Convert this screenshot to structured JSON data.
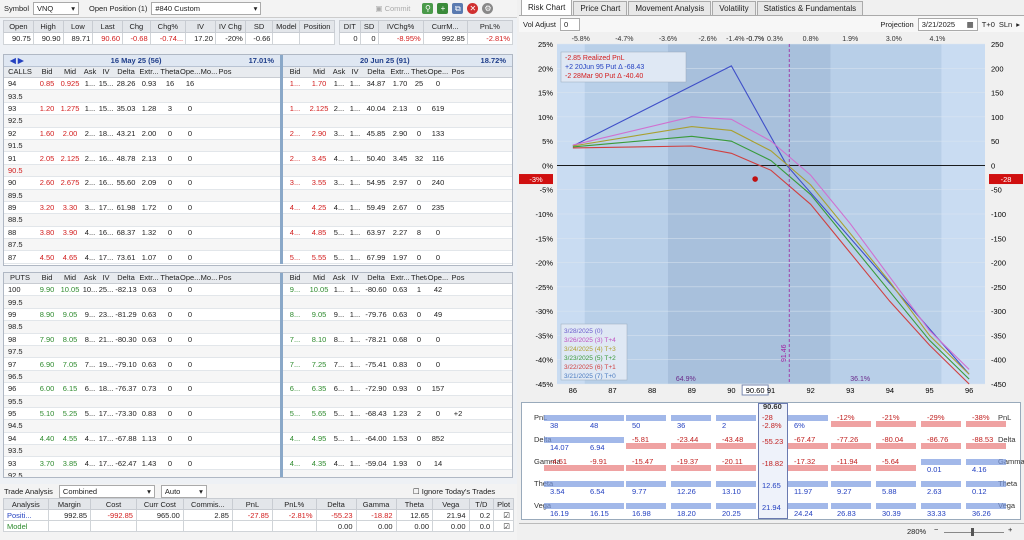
{
  "toolbar": {
    "symbol_label": "Symbol",
    "symbol_value": "VNQ",
    "open_position_label": "Open Position (1)",
    "position_value": "#840 Custom",
    "commit_label": "Commit"
  },
  "quote": {
    "headers": [
      "Open",
      "High",
      "Low",
      "Last",
      "Chg",
      "Chg%",
      "IV",
      "IV Chg",
      "SD",
      "Model",
      "Position"
    ],
    "values": [
      "90.75",
      "90.90",
      "89.71",
      "90.60",
      "-0.68",
      "-0.74...",
      "17.20",
      "-20%",
      "-0.66",
      "",
      ""
    ],
    "headers2": [
      "DIT",
      "SD",
      "IVChg%",
      "CurrM...",
      "PnL%"
    ],
    "values2": [
      "0",
      "0",
      "-8.95%",
      "992.85",
      "-2.81%"
    ]
  },
  "calls_panel": {
    "label": "CALLS",
    "left_title": "16 May 25 (56)",
    "left_iv": "17.01%",
    "right_title": "20 Jun 25 (91)",
    "right_iv": "18.72%",
    "columns": [
      "Bid",
      "Mid",
      "Ask",
      "IV",
      "Delta",
      "Extr...",
      "Theta",
      "Ope...",
      "Mo...",
      "Pos"
    ],
    "rows_left": [
      [
        "94",
        "0.85",
        "0.925",
        "1...",
        "15...",
        "28.26",
        "0.93",
        "16",
        "16",
        ""
      ],
      [
        "93.5",
        "",
        "",
        "",
        "",
        "",
        "",
        "",
        "",
        ""
      ],
      [
        "93",
        "1.20",
        "1.275",
        "1...",
        "15...",
        "35.03",
        "1.28",
        "3",
        "0",
        ""
      ],
      [
        "92.5",
        "",
        "",
        "",
        "",
        "",
        "",
        "",
        "",
        ""
      ],
      [
        "92",
        "1.60",
        "2.00",
        "2...",
        "18...",
        "43.21",
        "2.00",
        "0",
        "0",
        ""
      ],
      [
        "91.5",
        "",
        "",
        "",
        "",
        "",
        "",
        "",
        "",
        ""
      ],
      [
        "91",
        "2.05",
        "2.125",
        "2...",
        "16...",
        "48.78",
        "2.13",
        "0",
        "0",
        ""
      ],
      [
        "90.5",
        "",
        "",
        "",
        "",
        "",
        "",
        "",
        "",
        ""
      ],
      [
        "90",
        "2.60",
        "2.675",
        "2...",
        "16...",
        "55.60",
        "2.09",
        "0",
        "0",
        ""
      ],
      [
        "89.5",
        "",
        "",
        "",
        "",
        "",
        "",
        "",
        "",
        ""
      ],
      [
        "89",
        "3.20",
        "3.30",
        "3...",
        "17...",
        "61.98",
        "1.72",
        "0",
        "0",
        ""
      ],
      [
        "88.5",
        "",
        "",
        "",
        "",
        "",
        "",
        "",
        "",
        ""
      ],
      [
        "88",
        "3.80",
        "3.90",
        "4...",
        "16...",
        "68.37",
        "1.32",
        "0",
        "0",
        ""
      ],
      [
        "87.5",
        "",
        "",
        "",
        "",
        "",
        "",
        "",
        "",
        ""
      ],
      [
        "87",
        "4.50",
        "4.65",
        "4...",
        "17...",
        "73.61",
        "1.07",
        "0",
        "0",
        ""
      ]
    ],
    "rows_right": [
      [
        "1...",
        "1.70",
        "1...",
        "1...",
        "34.87",
        "1.70",
        "25",
        "0",
        ""
      ],
      [
        "",
        "",
        "",
        "",
        "",
        "",
        "",
        "",
        ""
      ],
      [
        "1...",
        "2.125",
        "2...",
        "1...",
        "40.04",
        "2.13",
        "0",
        "619",
        ""
      ],
      [
        "",
        "",
        "",
        "",
        "",
        "",
        "",
        "",
        ""
      ],
      [
        "2...",
        "2.90",
        "3...",
        "1...",
        "45.85",
        "2.90",
        "0",
        "133",
        ""
      ],
      [
        "",
        "",
        "",
        "",
        "",
        "",
        "",
        "",
        ""
      ],
      [
        "2...",
        "3.45",
        "4...",
        "1...",
        "50.40",
        "3.45",
        "32",
        "116",
        ""
      ],
      [
        "",
        "",
        "",
        "",
        "",
        "",
        "",
        "",
        ""
      ],
      [
        "3...",
        "3.55",
        "3...",
        "1...",
        "54.95",
        "2.97",
        "0",
        "240",
        ""
      ],
      [
        "",
        "",
        "",
        "",
        "",
        "",
        "",
        "",
        ""
      ],
      [
        "4...",
        "4.25",
        "4...",
        "1...",
        "59.49",
        "2.67",
        "0",
        "235",
        ""
      ],
      [
        "",
        "",
        "",
        "",
        "",
        "",
        "",
        "",
        ""
      ],
      [
        "4...",
        "4.85",
        "5...",
        "1...",
        "63.97",
        "2.27",
        "8",
        "0",
        ""
      ],
      [
        "",
        "",
        "",
        "",
        "",
        "",
        "",
        "",
        ""
      ],
      [
        "5...",
        "5.55",
        "5...",
        "1...",
        "67.99",
        "1.97",
        "0",
        "0",
        ""
      ]
    ]
  },
  "puts_panel": {
    "label": "PUTS",
    "rows_left": [
      [
        "100",
        "9.90",
        "10.05",
        "10...",
        "25...",
        "-82.13",
        "0.63",
        "0",
        "0",
        ""
      ],
      [
        "99.5",
        "",
        "",
        "",
        "",
        "",
        "",
        "",
        "",
        ""
      ],
      [
        "99",
        "8.90",
        "9.05",
        "9...",
        "23...",
        "-81.29",
        "0.63",
        "0",
        "0",
        ""
      ],
      [
        "98.5",
        "",
        "",
        "",
        "",
        "",
        "",
        "",
        "",
        ""
      ],
      [
        "98",
        "7.90",
        "8.05",
        "8...",
        "21...",
        "-80.30",
        "0.63",
        "0",
        "0",
        ""
      ],
      [
        "97.5",
        "",
        "",
        "",
        "",
        "",
        "",
        "",
        "",
        ""
      ],
      [
        "97",
        "6.90",
        "7.05",
        "7...",
        "19...",
        "-79.10",
        "0.63",
        "0",
        "0",
        ""
      ],
      [
        "96.5",
        "",
        "",
        "",
        "",
        "",
        "",
        "",
        "",
        ""
      ],
      [
        "96",
        "6.00",
        "6.15",
        "6...",
        "18...",
        "-76.37",
        "0.73",
        "0",
        "0",
        ""
      ],
      [
        "95.5",
        "",
        "",
        "",
        "",
        "",
        "",
        "",
        "",
        ""
      ],
      [
        "95",
        "5.10",
        "5.25",
        "5...",
        "17...",
        "-73.30",
        "0.83",
        "0",
        "0",
        ""
      ],
      [
        "94.5",
        "",
        "",
        "",
        "",
        "",
        "",
        "",
        "",
        ""
      ],
      [
        "94",
        "4.40",
        "4.55",
        "4...",
        "17...",
        "-67.88",
        "1.13",
        "0",
        "0",
        ""
      ],
      [
        "93.5",
        "",
        "",
        "",
        "",
        "",
        "",
        "",
        "",
        ""
      ],
      [
        "93",
        "3.70",
        "3.85",
        "4...",
        "17...",
        "-62.47",
        "1.43",
        "0",
        "0",
        ""
      ],
      [
        "92.5",
        "",
        "",
        "",
        "",
        "",
        "",
        "",
        "",
        ""
      ]
    ],
    "rows_right": [
      [
        "9...",
        "10.05",
        "1...",
        "1...",
        "-80.60",
        "0.63",
        "1",
        "42",
        ""
      ],
      [
        "",
        "",
        "",
        "",
        "",
        "",
        "",
        "",
        ""
      ],
      [
        "8...",
        "9.05",
        "9...",
        "1...",
        "-79.76",
        "0.63",
        "0",
        "49",
        ""
      ],
      [
        "",
        "",
        "",
        "",
        "",
        "",
        "",
        "",
        ""
      ],
      [
        "7...",
        "8.10",
        "8...",
        "1...",
        "-78.21",
        "0.68",
        "0",
        "0",
        ""
      ],
      [
        "",
        "",
        "",
        "",
        "",
        "",
        "",
        "",
        ""
      ],
      [
        "7...",
        "7.25",
        "7...",
        "1...",
        "-75.41",
        "0.83",
        "0",
        "0",
        ""
      ],
      [
        "",
        "",
        "",
        "",
        "",
        "",
        "",
        "",
        ""
      ],
      [
        "6...",
        "6.35",
        "6...",
        "1...",
        "-72.90",
        "0.93",
        "0",
        "157",
        ""
      ],
      [
        "",
        "",
        "",
        "",
        "",
        "",
        "",
        "",
        ""
      ],
      [
        "5...",
        "5.65",
        "5...",
        "1...",
        "-68.43",
        "1.23",
        "2",
        "0",
        "+2"
      ],
      [
        "",
        "",
        "",
        "",
        "",
        "",
        "",
        "",
        ""
      ],
      [
        "4...",
        "4.95",
        "5...",
        "1...",
        "-64.00",
        "1.53",
        "0",
        "852",
        ""
      ],
      [
        "",
        "",
        "",
        "",
        "",
        "",
        "",
        "",
        ""
      ],
      [
        "4...",
        "4.35",
        "4...",
        "1...",
        "-59.04",
        "1.93",
        "0",
        "14",
        ""
      ],
      [
        "",
        "",
        "",
        "",
        "",
        "",
        "",
        "",
        ""
      ]
    ]
  },
  "analysis": {
    "title": "Trade Analysis",
    "mode": "Combined",
    "auto": "Auto",
    "ignore_label": "Ignore Today's Trades",
    "headers": [
      "Analysis",
      "Margin",
      "Cost",
      "Curr Cost",
      "Commis...",
      "PnL",
      "PnL%",
      "Delta",
      "Gamma",
      "Theta",
      "Vega",
      "T/D",
      "Plot"
    ],
    "rows": [
      [
        "Positi...",
        "992.85",
        "-992.85",
        "965.00",
        "2.85",
        "-27.85",
        "-2.81%",
        "-55.23",
        "-18.82",
        "12.65",
        "21.94",
        "0.2",
        ""
      ],
      [
        "Model",
        "",
        "",
        "",
        "",
        "",
        "",
        "0.00",
        "0.00",
        "0.00",
        "0.00",
        "0.0",
        ""
      ]
    ]
  },
  "chart_tabs": [
    "Risk Chart",
    "Price Chart",
    "Movement Analysis",
    "Volatility",
    "Statistics & Fundamentals"
  ],
  "chart_controls": {
    "vol_adjust_label": "Vol Adjust",
    "vol_adjust_value": "0",
    "projection_label": "Projection",
    "projection_date": "3/21/2025",
    "t0_label": "T+0",
    "sln_label": "SLn"
  },
  "chart_data": {
    "type": "line",
    "x_ticks": [
      "86",
      "87",
      "88",
      "89",
      "90",
      "90.60",
      "91",
      "92",
      "93",
      "94",
      "95",
      "96"
    ],
    "top_pct_ticks": [
      "-5.8%",
      "-4.7%",
      "-3.6%",
      "-2.6%",
      "-1.4%",
      "-0.7%",
      "0.3%",
      "0.8%",
      "1.9%",
      "3.0%",
      "4.1%"
    ],
    "y_left_ticks": [
      "25%",
      "20%",
      "15%",
      "10%",
      "5%",
      "0%",
      "-3%",
      "-5%",
      "-10%",
      "-15%",
      "-20%",
      "-25%",
      "-30%",
      "-35%",
      "-40%",
      "-45%"
    ],
    "y_right_ticks": [
      "250",
      "200",
      "150",
      "100",
      "50",
      "0",
      "-28",
      "-50",
      "-100",
      "-150",
      "-200",
      "-250",
      "-300",
      "-350",
      "-400",
      "-450"
    ],
    "current_pnl_pct": "-3%",
    "current_pnl": "-28",
    "legend_top": [
      {
        "label": "-2.85 Realized PnL",
        "color": "#d21d1d"
      },
      {
        "label": "+2 20Jun 95 Put Δ -68.43",
        "color": "#2441c0"
      },
      {
        "label": "-2 28Mar 90 Put Δ -40.40",
        "color": "#d21d1d"
      }
    ],
    "legend_bottom": [
      {
        "label": "3/28/2025 (0)",
        "color": "#6a5acd"
      },
      {
        "label": "3/26/2025 (3) T+4",
        "color": "#c050c0"
      },
      {
        "label": "3/24/2025 (4) T+3",
        "color": "#b0a030"
      },
      {
        "label": "3/23/2025 (5) T+2",
        "color": "#3a9a3a"
      },
      {
        "label": "3/22/2025 (6) T+1",
        "color": "#d04040"
      },
      {
        "label": "3/21/2025 (7) T+0",
        "color": "#4a7ac0"
      }
    ],
    "zone_labels": [
      "64.9%",
      "36.1%"
    ],
    "breakeven_label": "91.46",
    "series": [
      {
        "x": [
          86,
          90,
          91.4,
          96
        ],
        "y": [
          40,
          205,
          0,
          -430
        ],
        "color": "#3f4fc8"
      },
      {
        "x": [
          86,
          89,
          90,
          91,
          92,
          93,
          94,
          95,
          96
        ],
        "y": [
          42,
          100,
          95,
          50,
          -20,
          -120,
          -230,
          -340,
          -420
        ],
        "color": "#d070d0"
      },
      {
        "x": [
          86,
          89,
          90,
          91,
          92,
          93,
          94,
          95,
          96
        ],
        "y": [
          40,
          80,
          72,
          30,
          -40,
          -140,
          -240,
          -350,
          -430
        ],
        "color": "#a8a030"
      },
      {
        "x": [
          86,
          89,
          90,
          91,
          92,
          93,
          94,
          95,
          96
        ],
        "y": [
          38,
          60,
          50,
          10,
          -60,
          -160,
          -260,
          -360,
          -440
        ],
        "color": "#3a9a3a"
      },
      {
        "x": [
          86,
          89,
          90,
          91,
          92,
          93,
          94,
          95,
          96
        ],
        "y": [
          36,
          40,
          25,
          -10,
          -80,
          -180,
          -280,
          -370,
          -450
        ],
        "color": "#d04040"
      }
    ]
  },
  "greeks_strip": {
    "current": "90.60",
    "pnl": {
      "label": "PnL",
      "highlight": "-28",
      "highlight2": "-2.8%",
      "vals": [
        "38",
        "48",
        "50",
        "36",
        "2",
        "6%",
        "-12%",
        "-21%",
        "-29%",
        "-38%"
      ]
    },
    "delta": {
      "label": "Delta",
      "highlight": "-55.23",
      "vals": [
        "14.07",
        "6.94",
        "-5.81",
        "-23.44",
        "-43.48",
        "-67.47",
        "-77.26",
        "-80.04",
        "-86.76",
        "-88.53"
      ]
    },
    "gamma": {
      "label": "Gamma",
      "highlight": "-18.82",
      "vals": [
        "-4.51",
        "-9.91",
        "-15.47",
        "-19.37",
        "-20.11",
        "-17.32",
        "-11.94",
        "-5.64",
        "0.01",
        "4.16"
      ]
    },
    "theta": {
      "label": "Theta",
      "highlight": "12.65",
      "vals": [
        "3.54",
        "6.54",
        "9.77",
        "12.26",
        "13.10",
        "11.97",
        "9.27",
        "5.88",
        "2.63",
        "0.12"
      ]
    },
    "vega": {
      "label": "Vega",
      "highlight": "21.94",
      "vals": [
        "16.19",
        "16.15",
        "16.98",
        "18.20",
        "20.25",
        "24.24",
        "26.83",
        "30.39",
        "33.33",
        "36.26"
      ]
    }
  },
  "zoom": "280%"
}
